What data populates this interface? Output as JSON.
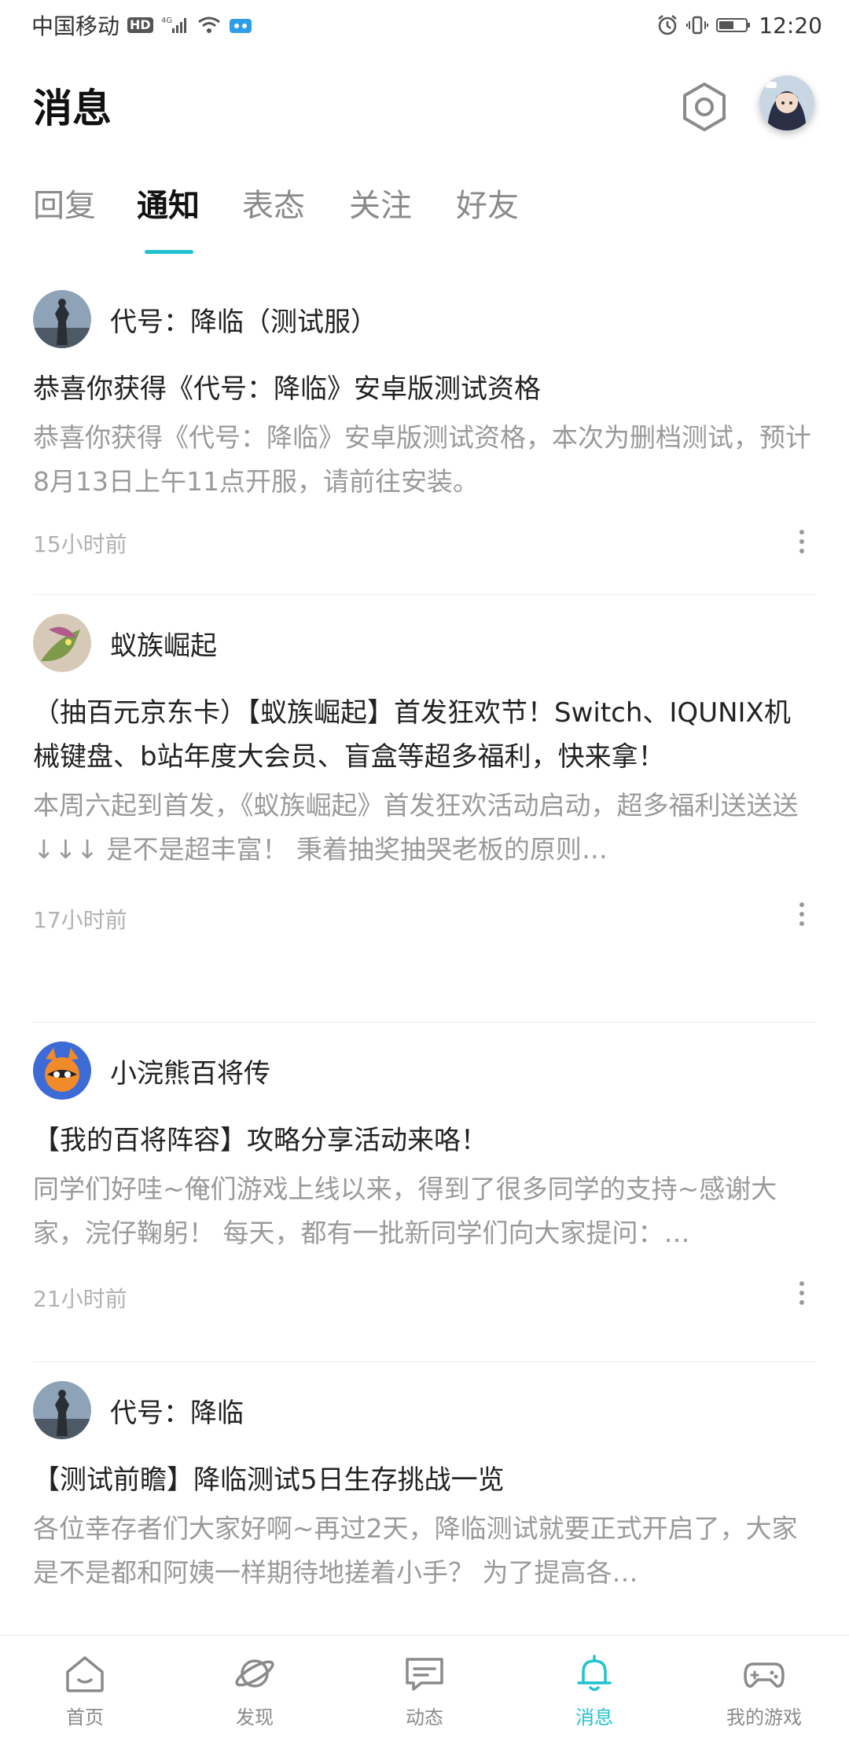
{
  "status_bar": {
    "carrier": "中国移动",
    "hd": "HD",
    "network": "4G",
    "time": "12:20"
  },
  "header": {
    "title": "消息"
  },
  "tabs": [
    {
      "label": "回复",
      "active": false
    },
    {
      "label": "通知",
      "active": true
    },
    {
      "label": "表态",
      "active": false
    },
    {
      "label": "关注",
      "active": false
    },
    {
      "label": "好友",
      "active": false
    }
  ],
  "notifications": [
    {
      "source": "代号：降临（测试服）",
      "title": "恭喜你获得《代号：降临》安卓版测试资格",
      "body": "恭喜你获得《代号：降临》安卓版测试资格，本次为删档测试，预计8月13日上午11点开服，请前往安装。",
      "time": "15小时前"
    },
    {
      "source": "蚁族崛起",
      "title": "（抽百元京东卡）【蚁族崛起】首发狂欢节！Switch、IQUNIX机械键盘、b站年度大会员、盲盒等超多福利，快来拿！",
      "body": "本周六起到首发，《蚁族崛起》首发狂欢活动启动，超多福利送送送↓↓↓ 是不是超丰富！ 秉着抽奖抽哭老板的原则…",
      "time": "17小时前"
    },
    {
      "source": "小浣熊百将传",
      "title": "【我的百将阵容】攻略分享活动来咯！",
      "body": "同学们好哇~俺们游戏上线以来，得到了很多同学的支持~感谢大家，浣仔鞠躬！ 每天，都有一批新同学们向大家提问：…",
      "time": "21小时前"
    },
    {
      "source": "代号：降临",
      "title": "【测试前瞻】降临测试5日生存挑战一览",
      "body": "各位幸存者们大家好啊~再过2天，降临测试就要正式开启了，大家是不是都和阿姨一样期待地搓着小手？ 为了提高各…",
      "time": ""
    }
  ],
  "bottom_nav": [
    {
      "label": "首页",
      "icon": "home-icon",
      "active": false
    },
    {
      "label": "发现",
      "icon": "planet-icon",
      "active": false
    },
    {
      "label": "动态",
      "icon": "chat-icon",
      "active": false
    },
    {
      "label": "消息",
      "icon": "bell-icon",
      "active": true
    },
    {
      "label": "我的游戏",
      "icon": "gamepad-icon",
      "active": false
    }
  ],
  "colors": {
    "accent": "#23c2d1",
    "muted_text": "#9a9a9a",
    "time_text": "#b2b2b2"
  }
}
